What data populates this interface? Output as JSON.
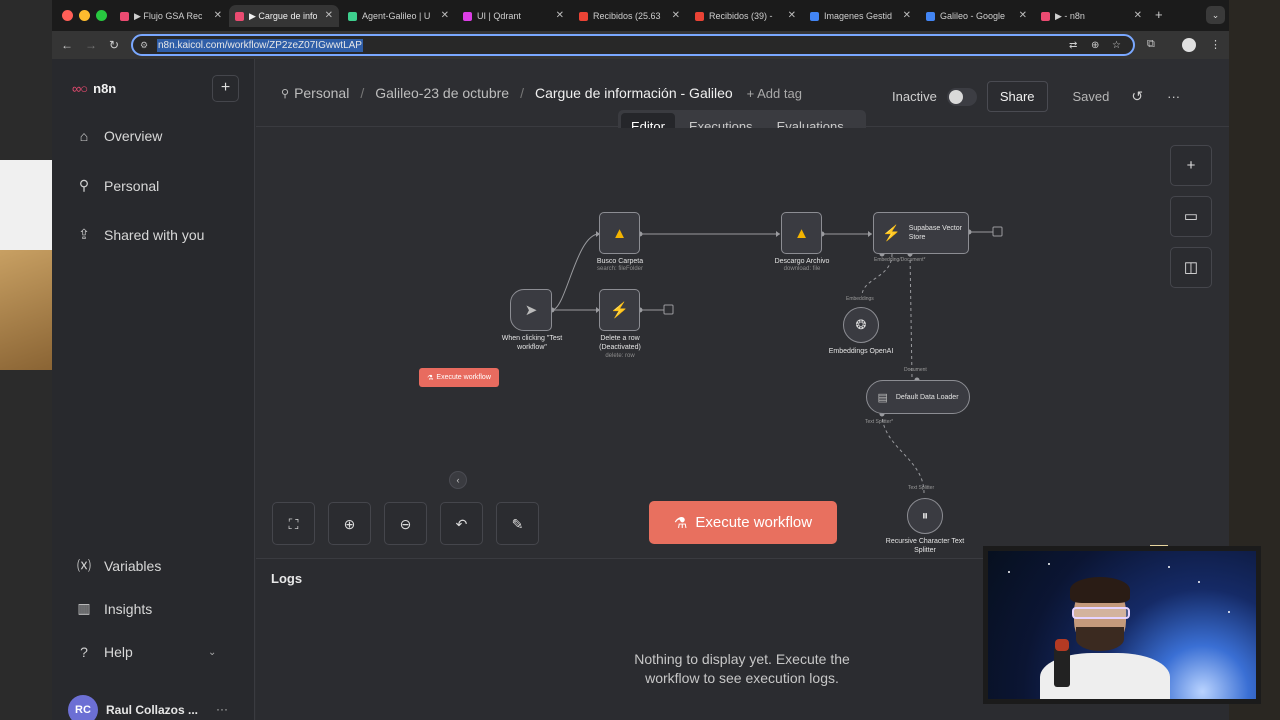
{
  "browser": {
    "tabs": [
      {
        "label": "▶ Flujo GSA Rec",
        "active": false,
        "icon_color": "#ea4b71"
      },
      {
        "label": "▶ Cargue de info",
        "active": true,
        "icon_color": "#ea4b71"
      },
      {
        "label": "Agent-Galileo | U",
        "active": false,
        "icon_color": "#3ecf8e"
      },
      {
        "label": "UI | Qdrant",
        "active": false,
        "icon_color": "#dc3ee6"
      },
      {
        "label": "Recibidos (25.63",
        "active": false,
        "icon_color": "#ea4335"
      },
      {
        "label": "Recibidos (39) -",
        "active": false,
        "icon_color": "#ea4335"
      },
      {
        "label": "Imagenes Gestid",
        "active": false,
        "icon_color": "#4285f4"
      },
      {
        "label": "Galileo - Google",
        "active": false,
        "icon_color": "#4285f4"
      },
      {
        "label": "▶ - n8n",
        "active": false,
        "icon_color": "#ea4b71"
      }
    ],
    "url": "n8n.kaicol.com/workflow/ZP2zeZ07IGwwtLAP"
  },
  "sidebar": {
    "logo": "n8n",
    "items": [
      {
        "label": "Overview",
        "icon": "home-icon"
      },
      {
        "label": "Personal",
        "icon": "user-icon"
      },
      {
        "label": "Shared with you",
        "icon": "share-icon"
      }
    ],
    "bottom_items": [
      {
        "label": "Variables",
        "icon": "variables-icon"
      },
      {
        "label": "Insights",
        "icon": "insights-icon"
      },
      {
        "label": "Help",
        "icon": "help-icon"
      }
    ],
    "user": {
      "initials": "RC",
      "name": "Raul Collazos ..."
    }
  },
  "header": {
    "breadcrumbs": [
      "Personal",
      "Galileo-23 de octubre",
      "Cargue de información - Galileo"
    ],
    "add_tag": "+ Add tag",
    "status": "Inactive",
    "share": "Share",
    "saved": "Saved"
  },
  "view_tabs": [
    "Editor",
    "Executions",
    "Evaluations"
  ],
  "canvas": {
    "small_execute": "Execute workflow",
    "nodes": {
      "trigger": {
        "label": "When clicking \"Test workflow\""
      },
      "busco": {
        "label": "Busco Carpeta",
        "sub": "search: fileFolder"
      },
      "delete": {
        "label": "Delete a row (Deactivated)",
        "sub": "delete: row"
      },
      "descargo": {
        "label": "Descargo Archivo",
        "sub": "download: file"
      },
      "supabase": {
        "label": "Supabase Vector Store"
      },
      "embeddings": {
        "label": "Embeddings OpenAI"
      },
      "loader": {
        "label": "Default Data Loader"
      },
      "splitter": {
        "label": "Recursive Character Text Splitter"
      }
    },
    "connector_labels": {
      "embedding_doc": "Embedding/Document*",
      "embeddings": "Embeddings",
      "document": "Document",
      "text_splitter": "Text Splitter*",
      "text_splitter2": "Text Splitter"
    },
    "execute_button": "Execute workflow"
  },
  "logs": {
    "title": "Logs",
    "empty": "Nothing to display yet. Execute the workflow to see execution logs."
  },
  "colors": {
    "accent": "#ea4b71",
    "execute": "#e8705f",
    "bg": "#2d2e32"
  }
}
